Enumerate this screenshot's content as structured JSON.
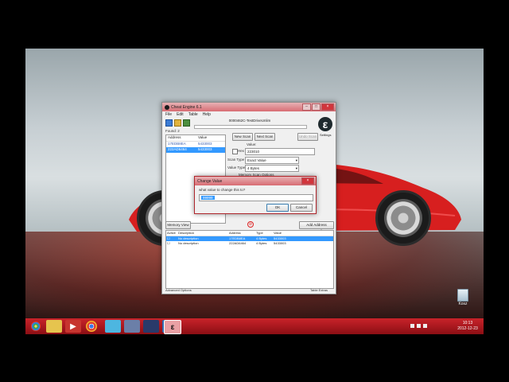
{
  "cheat_engine": {
    "title": "Cheat Engine 6.1",
    "menu": [
      "File",
      "Edit",
      "Table",
      "Help"
    ],
    "process": "0000462C-TestDriveUnlim",
    "found": "Found: 2",
    "columns": {
      "address": "Address",
      "value": "Value"
    },
    "results": [
      {
        "address": "17EDB8EA",
        "value": "5433003"
      },
      {
        "address": "222AD6464",
        "value": "5433003"
      }
    ],
    "buttons": {
      "new_scan": "New Scan",
      "next_scan": "Next Scan",
      "undo_scan": "Undo Scan"
    },
    "value_label": "Value:",
    "hex_label": "Hex",
    "scan_value": "223010",
    "scan_type_label": "Scan Type",
    "scan_type": "Exact Value",
    "value_type_label": "Value Type",
    "value_type": "4 Bytes",
    "memory_options": "Memory Scan Options",
    "settings": "Settings",
    "memory_view": "Memory View",
    "add_address": "Add Address Manually",
    "table_columns": [
      "Active",
      "Description",
      "Address",
      "Type",
      "Value"
    ],
    "table_rows": [
      {
        "description": "No description",
        "address": "17EDB8EA",
        "type": "4 Bytes",
        "value": "5433003"
      },
      {
        "description": "No description",
        "address": "222AD6464",
        "type": "4 Bytes",
        "value": "5433003"
      }
    ],
    "advanced": "Advanced Options",
    "table_extras": "Table Extras"
  },
  "dialog": {
    "title": "Change Value",
    "prompt": "what value to change this to?",
    "input_value": "99999",
    "ok": "OK",
    "cancel": "Cancel"
  },
  "desktop": {
    "recycle_bin": "Kosz"
  },
  "taskbar": {
    "time": "10:13",
    "date": "2012-12-23",
    "accent": "#b8141b"
  }
}
